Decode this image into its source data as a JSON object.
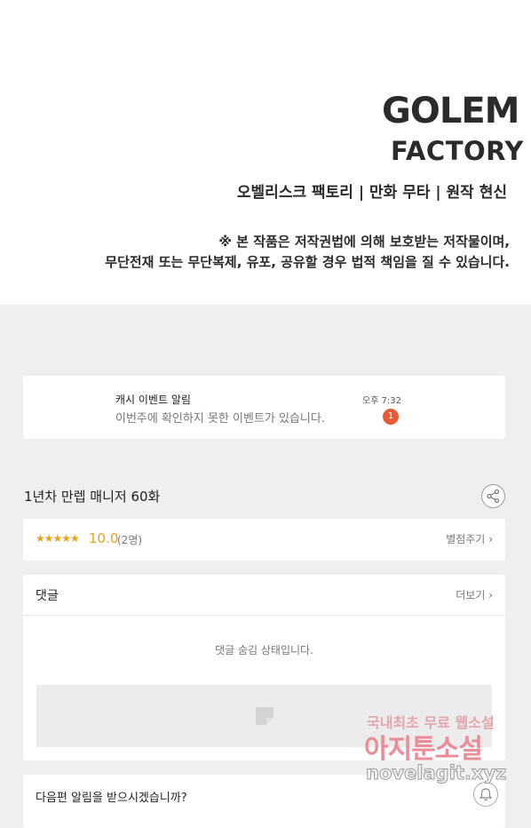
{
  "header": {
    "logo_line1": "GOLEM",
    "logo_line2": "FACTORY",
    "credits": "오벨리스크 팩토리 | 만화 무타 | 원작 현신",
    "notice_line1": "※ 본 작품은 저작권법에 의해 보호받는 저작물이며,",
    "notice_line2": "무단전재 또는 무단복제, 유포, 공유할 경우 법적 책임을 질 수 있습니다."
  },
  "notification": {
    "title": "캐시 이벤트 알림",
    "body": "이번주에 확인하지 못한 이벤트가 있습니다.",
    "time": "오후 7:32",
    "badge": "1"
  },
  "episode": {
    "title": "1년차 만렙 매니저 60화",
    "share_icon": "share-icon"
  },
  "rating": {
    "stars": "★★★★★",
    "score": "10.0",
    "count": "(2명)",
    "rate_label": "별점주기",
    "chevron": "›"
  },
  "comments": {
    "title": "댓글",
    "more_label": "더보기",
    "chevron": "›",
    "hidden_message": "댓글 숨김 상태입니다."
  },
  "next_episode": {
    "question": "다음편 알림을 받으시겠습니까?",
    "bell_icon": "bell-icon"
  },
  "watermark": {
    "line1": "국내최초 무료 웹소설",
    "line2": "아지툰소설",
    "line3": "novelagit.xyz"
  },
  "colors": {
    "accent": "#e7a21a",
    "badge": "#e85a33",
    "background": "#efefef"
  }
}
